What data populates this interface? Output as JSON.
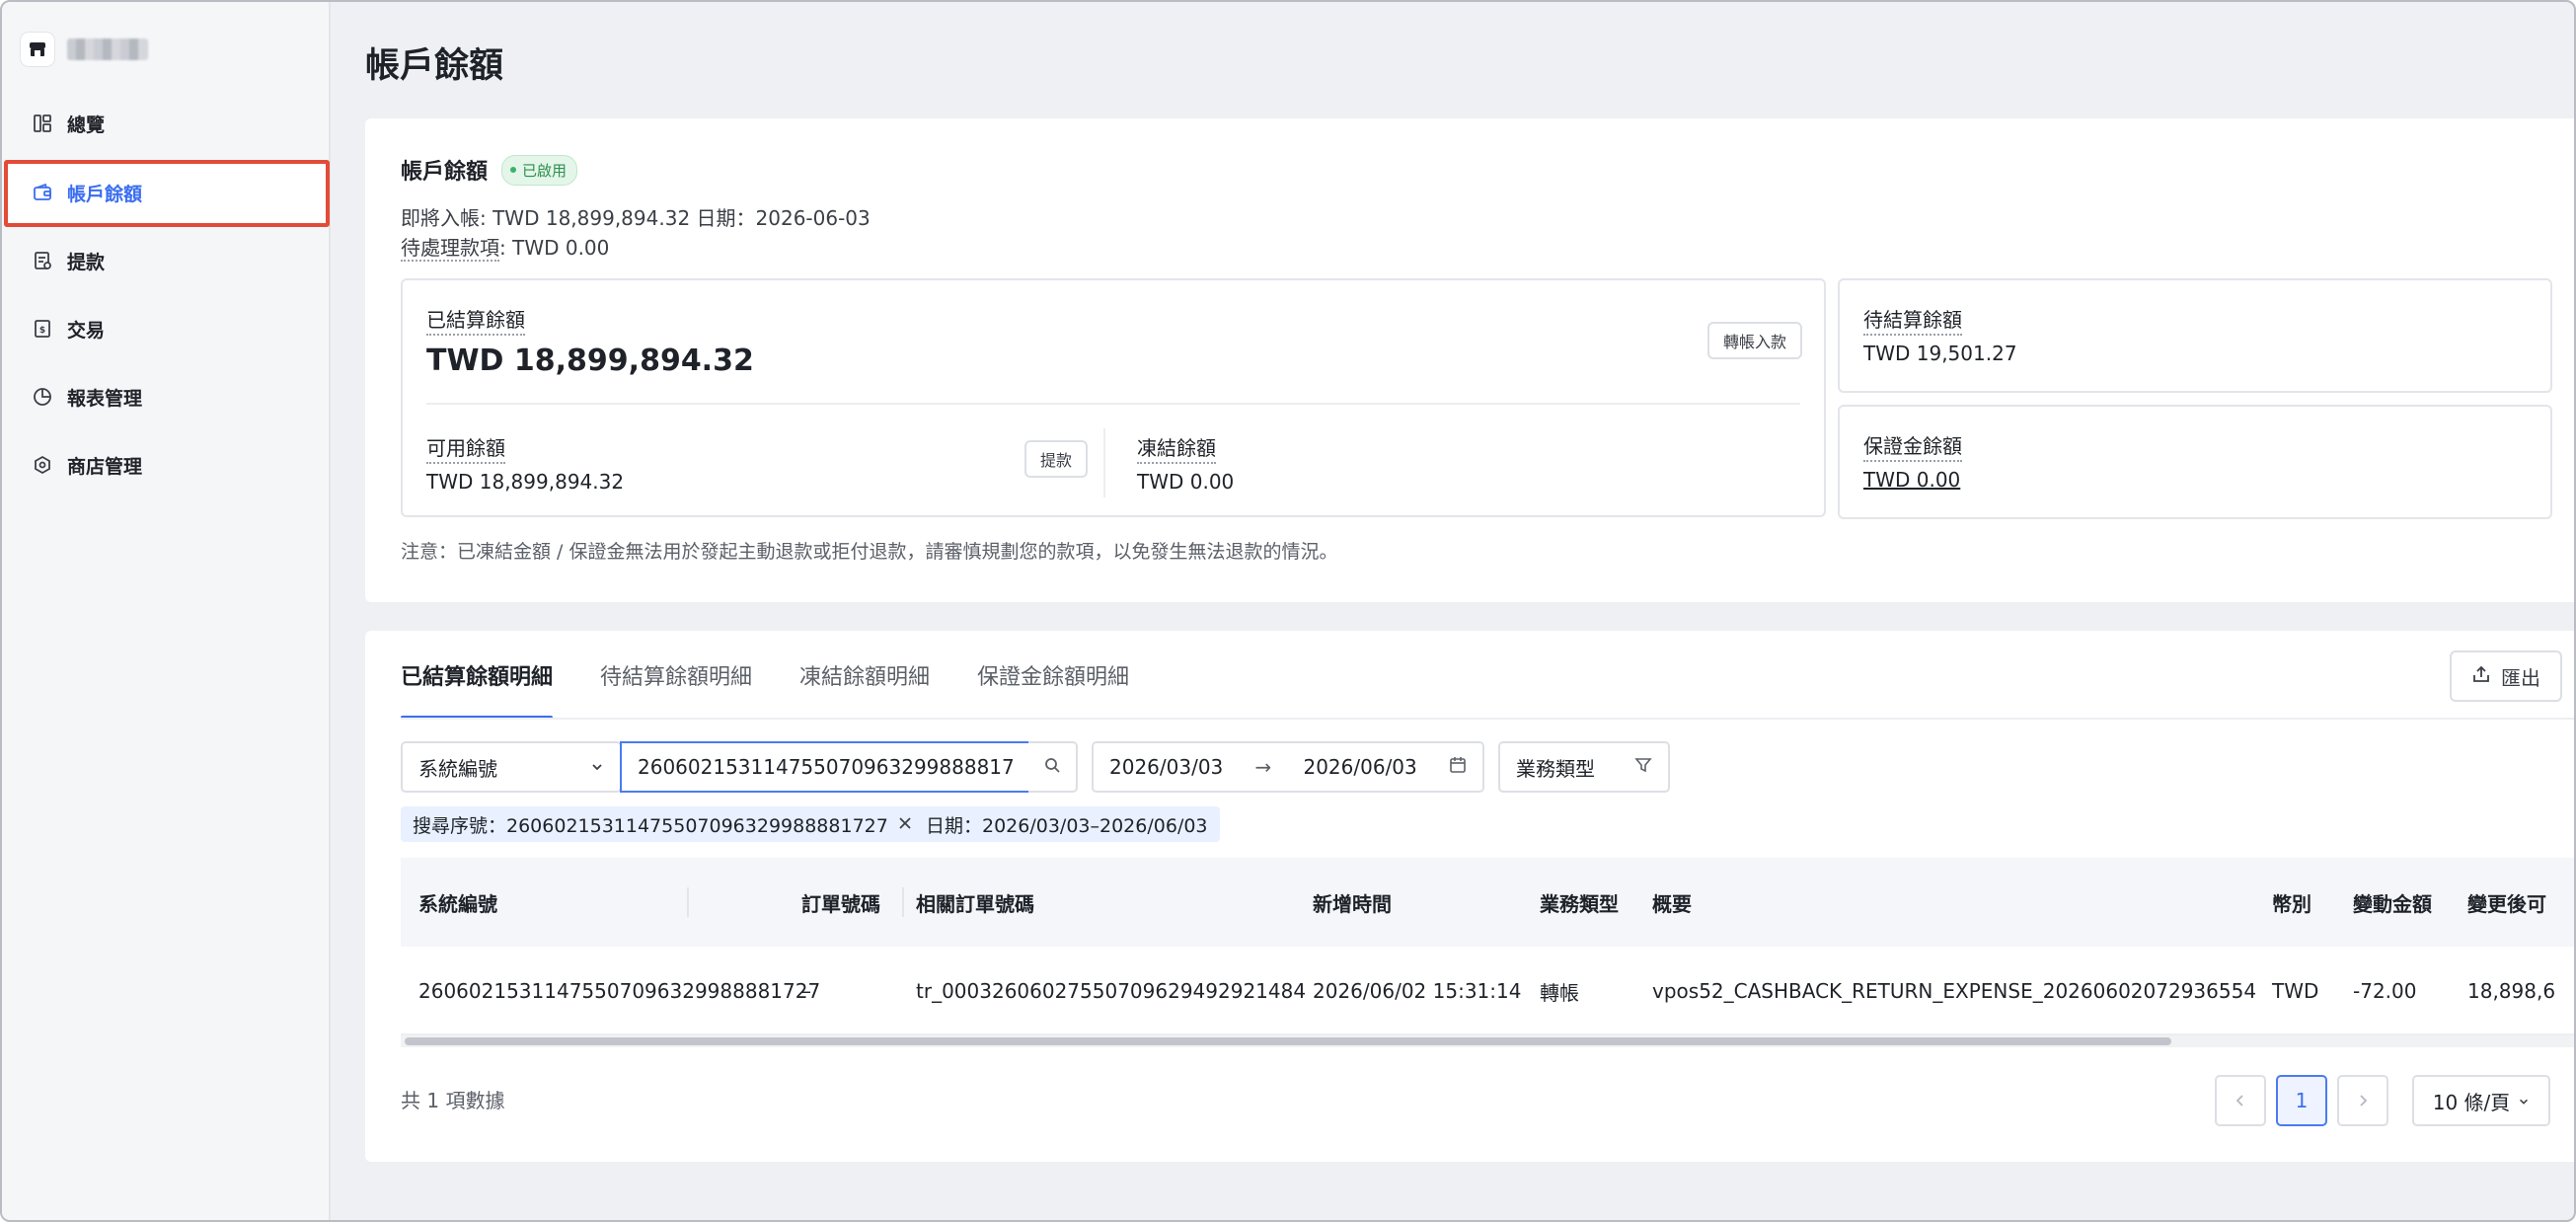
{
  "sidebar": {
    "brand_icon": "store-icon",
    "items": [
      {
        "label": "總覽",
        "icon": "dashboard-icon"
      },
      {
        "label": "帳戶餘額",
        "icon": "wallet-icon",
        "active": true
      },
      {
        "label": "提款",
        "icon": "withdraw-icon"
      },
      {
        "label": "交易",
        "icon": "transaction-icon"
      },
      {
        "label": "報表管理",
        "icon": "report-pie-icon"
      },
      {
        "label": "商店管理",
        "icon": "store-settings-icon"
      }
    ]
  },
  "page": {
    "title": "帳戶餘額"
  },
  "summary": {
    "title": "帳戶餘額",
    "status_badge": "已啟用",
    "upcoming_line": "即將入帳: TWD 18,899,894.32 日期：2026-06-03",
    "pending_label": "待處理款項",
    "pending_value": ": TWD 0.00",
    "settled": {
      "label": "已結算餘額",
      "value": "TWD 18,899,894.32",
      "transfer_button": "轉帳入款"
    },
    "available": {
      "label": "可用餘額",
      "value": "TWD 18,899,894.32",
      "withdraw_button": "提款"
    },
    "frozen": {
      "label": "凍結餘額",
      "value": "TWD 0.00"
    },
    "to_settle": {
      "label": "待結算餘額",
      "value": "TWD 19,501.27"
    },
    "deposit": {
      "label": "保證金餘額",
      "value": "TWD 0.00"
    },
    "note": "注意：已凍結金額 / 保證金無法用於發起主動退款或拒付退款，請審慎規劃您的款項，以免發生無法退款的情況。"
  },
  "detail": {
    "tabs": [
      "已結算餘額明細",
      "待結算餘額明細",
      "凍結餘額明細",
      "保證金餘額明細"
    ],
    "active_tab": 0,
    "export_label": "匯出",
    "search_field_select": "系統編號",
    "search_value": "26060215311475507096329988881727",
    "date_start": "2026/03/03",
    "date_end": "2026/06/03",
    "biz_type_label": "業務類型",
    "chips": [
      {
        "text": "搜尋序號：26060215311475507096329988881727",
        "closable": true
      },
      {
        "text": "日期：2026/03/03–2026/06/03",
        "closable": false
      }
    ],
    "columns": [
      "系統編號",
      "訂單號碼",
      "相關訂單號碼",
      "新增時間",
      "業務類型",
      "概要",
      "幣別",
      "變動金額",
      "變更後可"
    ],
    "rows": [
      [
        "26060215311475507096329988881727",
        "–",
        "tr_00032606027550709629492921484",
        "2026/06/02 15:31:14",
        "轉帳",
        "vpos52_CASHBACK_RETURN_EXPENSE_20260602072936554",
        "TWD",
        "-72.00",
        "18,898,6"
      ]
    ],
    "total_text": "共 1 項數據",
    "current_page": "1",
    "page_size": "10 條/頁"
  }
}
